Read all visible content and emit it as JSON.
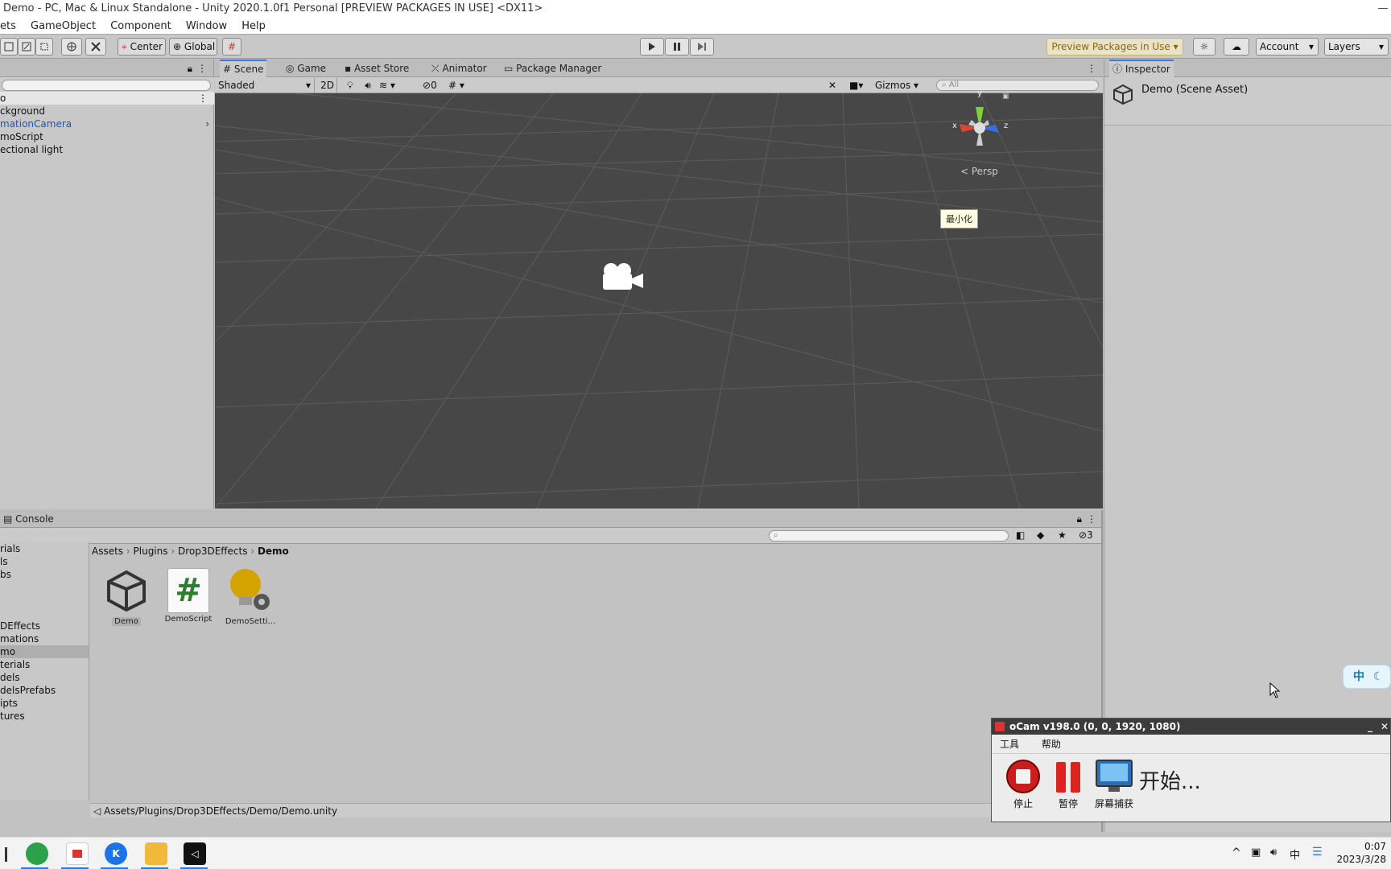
{
  "window": {
    "title": "Demo - PC, Mac & Linux Standalone - Unity 2020.1.0f1 Personal [PREVIEW PACKAGES IN USE] <DX11>"
  },
  "menu": [
    "ets",
    "GameObject",
    "Component",
    "Window",
    "Help"
  ],
  "toolbar": {
    "center_label": "Center",
    "global_label": "Global",
    "preview_label": "Preview Packages in Use",
    "account_label": "Account",
    "layers_label": "Layers"
  },
  "hierarchy": {
    "root": "o",
    "items": [
      "ckground",
      "mationCamera",
      "moScript",
      "ectional light"
    ]
  },
  "scene_tabs": [
    "Scene",
    "Game",
    "Asset Store",
    "Animator",
    "Package Manager"
  ],
  "scene_toolbar": {
    "shading": "Shaded",
    "mode_2d": "2D",
    "hidden_count": "0",
    "gizmos": "Gizmos",
    "search_placeholder": "All"
  },
  "scene_view": {
    "gizmo_y": "y",
    "gizmo_x": "x",
    "gizmo_z": "z",
    "projection": "< Persp",
    "tooltip": "最小化"
  },
  "inspector": {
    "tab": "Inspector",
    "object": "Demo (Scene Asset)"
  },
  "console": {
    "tab": "Console",
    "hidden_count": "3"
  },
  "project": {
    "tree": [
      "rials",
      "ls",
      "bs",
      "",
      "",
      "",
      "DEffects",
      "mations",
      "mo",
      "terials",
      "dels",
      "delsPrefabs",
      "ipts",
      "tures"
    ],
    "breadcrumb": [
      "Assets",
      "Plugins",
      "Drop3DEffects",
      "Demo"
    ],
    "assets": [
      {
        "name": "Demo",
        "icon": "unity-scene-icon"
      },
      {
        "name": "DemoScript",
        "icon": "csharp-script-icon"
      },
      {
        "name": "DemoSetti...",
        "icon": "settings-asset-icon"
      }
    ],
    "path": "Assets/Plugins/Drop3DEffects/Demo/Demo.unity"
  },
  "ime": {
    "label": "中"
  },
  "ocam": {
    "title": "oCam v198.0 (0, 0, 1920, 1080)",
    "menu": [
      "工具",
      "帮助"
    ],
    "stop": "停止",
    "pause": "暂停",
    "capture": "屏幕捕获",
    "status": "开始..."
  },
  "taskbar": {
    "time": "0:07",
    "date": "2023/3/28"
  },
  "colors": {
    "active_tab": "#3a78d8",
    "link": "#1a56b8",
    "preview_text": "#8d6a00"
  }
}
